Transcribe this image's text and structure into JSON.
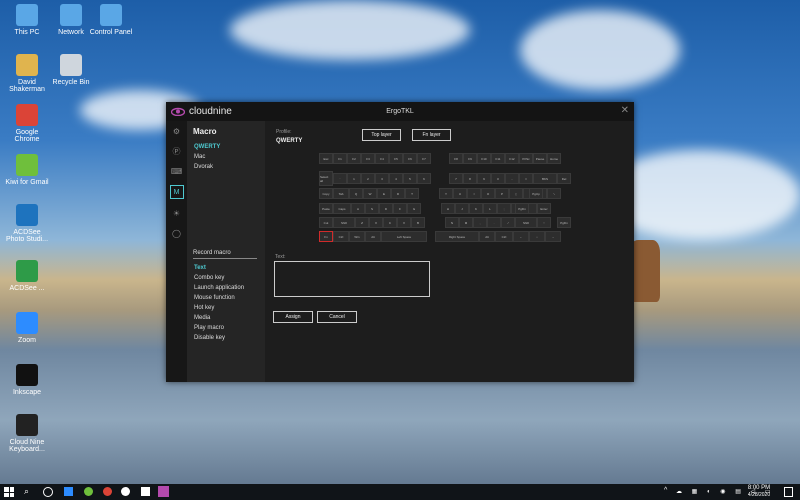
{
  "desktop": {
    "icons": [
      {
        "label": "This PC",
        "icon": "pc-icon",
        "color": "#5aa7e6"
      },
      {
        "label": "Network",
        "icon": "network-icon",
        "color": "#5aa7e6"
      },
      {
        "label": "Control Panel",
        "icon": "control-panel-icon",
        "color": "#5aa7e6"
      },
      {
        "label": "David Shakerman",
        "icon": "user-folder-icon",
        "color": "#e0b44e"
      },
      {
        "label": "Recycle Bin",
        "icon": "recycle-bin-icon",
        "color": "#cfd6dd"
      },
      {
        "label": "Google Chrome",
        "icon": "chrome-icon",
        "color": "#db4437"
      },
      {
        "label": "Kiwi for Gmail",
        "icon": "kiwi-icon",
        "color": "#6fbf3c"
      },
      {
        "label": "ACDSee Photo Studi...",
        "icon": "acdsee-icon",
        "color": "#1e73be"
      },
      {
        "label": "ACDSee ...",
        "icon": "acdsee-new-icon",
        "color": "#2e9b48"
      },
      {
        "label": "Zoom",
        "icon": "zoom-icon",
        "color": "#2d8cff"
      },
      {
        "label": "Inkscape",
        "icon": "inkscape-icon",
        "color": "#111111"
      },
      {
        "label": "Cloud Nine Keyboard...",
        "icon": "cloudnine-shortcut-icon",
        "color": "#222222"
      }
    ]
  },
  "window": {
    "brand": "cloudnine",
    "title": "ErgoTKL",
    "close": "✕"
  },
  "iconbar": [
    "settings-icon",
    "profile-icon",
    "keyboard-icon",
    "macro-icon",
    "lighting-icon",
    "circle-icon"
  ],
  "left": {
    "heading": "Macro",
    "profiles": [
      "QWERTY",
      "Mac",
      "Dvorak"
    ],
    "record_heading": "Record macro",
    "record_items": [
      "Text",
      "Combo key",
      "Launch application",
      "Mouse function",
      "Hot key",
      "Media",
      "Play macro",
      "Disable key"
    ]
  },
  "main": {
    "profile_label": "Profile:",
    "profile_value": "QWERTY",
    "top_layer": "Top layer",
    "fn_layer": "Fn layer",
    "text_label": "Text:",
    "assign": "Assign",
    "cancel": "Cancel"
  },
  "keyboard": {
    "rows": [
      [
        "Esc",
        "F1",
        "F2",
        "F3",
        "F4",
        "F5",
        "F6",
        "F7",
        "F8",
        "F9",
        "F10",
        "F11",
        "F12",
        "PrtSc",
        "Pause",
        "Home"
      ],
      [
        "Select all",
        "`",
        "1",
        "2",
        "3",
        "4",
        "5",
        "6",
        "7",
        "8",
        "9",
        "0",
        "-",
        "=",
        "BKS",
        "Del"
      ],
      [
        "Copy",
        "Tab",
        "Q",
        "W",
        "E",
        "R",
        "T",
        "Y",
        "U",
        "I",
        "O",
        "P",
        "[",
        "]",
        "\\",
        "PgUp"
      ],
      [
        "Paste",
        "Caps",
        "A",
        "S",
        "D",
        "F",
        "G",
        "H",
        "J",
        "K",
        "L",
        ";",
        "'",
        "Enter",
        "PgDn"
      ],
      [
        "Cut",
        "Shift",
        "Z",
        "X",
        "C",
        "V",
        "B",
        "N",
        "M",
        ",",
        ".",
        "/",
        "Shift",
        "↑",
        "PgDn"
      ],
      [
        "Fn",
        "Ctrl",
        "Win",
        "Alt",
        "Left Space",
        "Right Space",
        "Alt",
        "Ctrl",
        "←",
        "↓",
        "→"
      ]
    ]
  },
  "taskbar": {
    "time": "8:00 PM",
    "date": "4/28/2020",
    "tray": "^"
  }
}
